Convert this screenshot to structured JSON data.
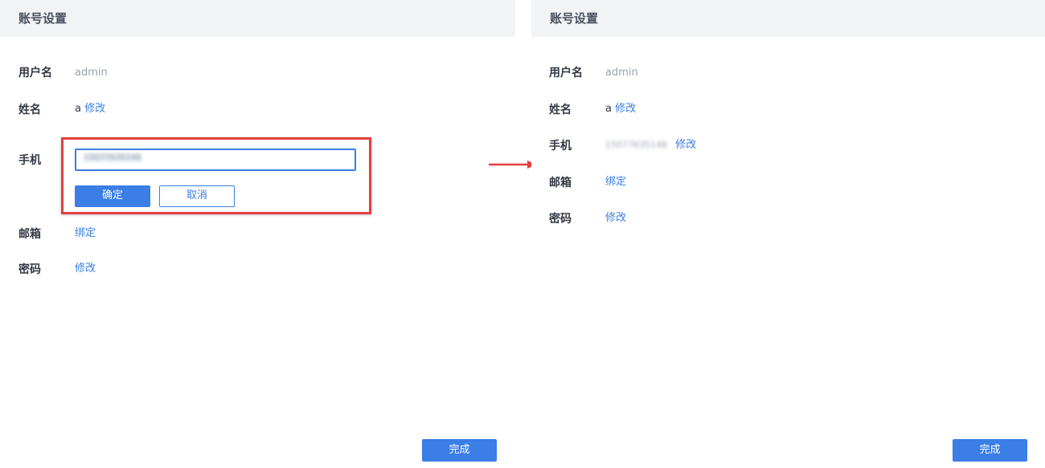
{
  "left_panel": {
    "title": "账号设置",
    "username": {
      "label": "用户名",
      "value": "admin"
    },
    "name": {
      "label": "姓名",
      "value": "a",
      "action": "修改"
    },
    "phone": {
      "label": "手机",
      "input_value": "15077635148",
      "confirm_label": "确定",
      "cancel_label": "取消"
    },
    "email": {
      "label": "邮箱",
      "action": "绑定"
    },
    "password": {
      "label": "密码",
      "action": "修改"
    },
    "done_label": "完成"
  },
  "right_panel": {
    "title": "账号设置",
    "username": {
      "label": "用户名",
      "value": "admin"
    },
    "name": {
      "label": "姓名",
      "value": "a",
      "action": "修改"
    },
    "phone": {
      "label": "手机",
      "value": "15077635148",
      "action": "修改"
    },
    "email": {
      "label": "邮箱",
      "action": "绑定"
    },
    "password": {
      "label": "密码",
      "action": "修改"
    },
    "done_label": "完成"
  },
  "colors": {
    "accent": "#3a7ee6",
    "highlight_border": "#e43f3f",
    "header_bg": "#f2f3f5",
    "arrow": "#e43f3f"
  }
}
